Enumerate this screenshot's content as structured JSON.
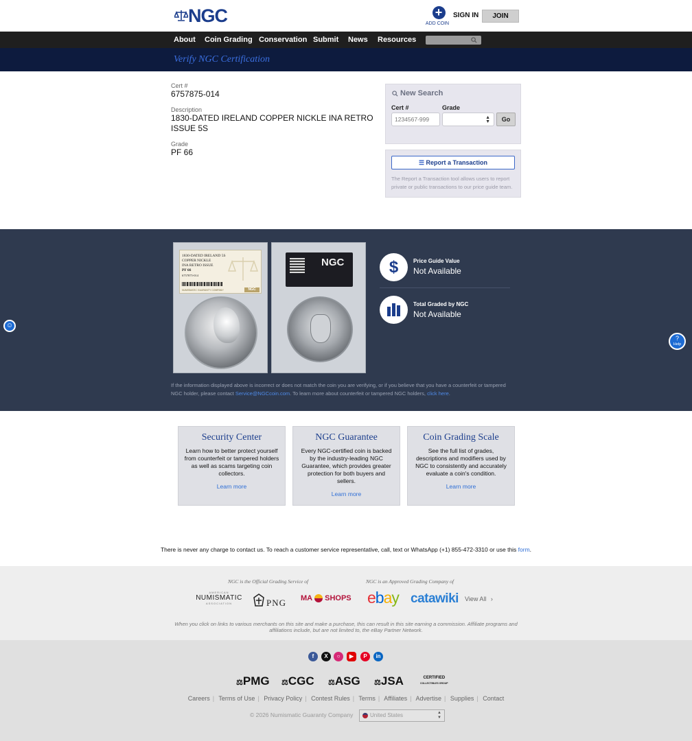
{
  "header": {
    "logo": "NGC",
    "add_coin": "ADD COIN",
    "sign_in": "SIGN IN",
    "join": "JOIN"
  },
  "nav": {
    "items": [
      "About",
      "Coin Grading",
      "Conservation",
      "Submit",
      "News",
      "Resources"
    ]
  },
  "verify": {
    "title": "Verify NGC Certification"
  },
  "cert": {
    "cert_label": "Cert #",
    "cert_value": "6757875-014",
    "desc_label": "Description",
    "desc_value": "1830-DATED IRELAND COPPER NICKLE INA RETRO ISSUE 5S",
    "grade_label": "Grade",
    "grade_value": "PF 66"
  },
  "new_search": {
    "title": "New Search",
    "cert_label": "Cert #",
    "cert_placeholder": "1234567-999",
    "grade_label": "Grade",
    "go": "Go"
  },
  "report": {
    "button": "Report a Transaction",
    "text": "The Report a Transaction tool allows users to report private or public transactions to our price guide team."
  },
  "slab": {
    "line1": "1830-DATED IRELAND 5S",
    "line2": "COPPER NICKLE",
    "line3": "INA RETRO ISSUE",
    "grade": "PF 66",
    "cert": "6757875-014",
    "guarantee": "NUMISMATIC GUARANTY COMPANY",
    "brand": "NGC"
  },
  "stats": {
    "price_label": "Price Guide Value",
    "price_value": "Not Available",
    "graded_label": "Total Graded by NGC",
    "graded_value": "Not Available"
  },
  "notice": {
    "text1": "If the information displayed above is incorrect or does not match the coin you are verifying, or if you believe that you have a counterfeit or tampered NGC holder, please contact ",
    "email": "Service@NGCcoin.com",
    "text2": ". To learn more about counterfeit or tampered NGC holders, ",
    "click": "click here",
    "text3": "."
  },
  "help": "Help",
  "cards": [
    {
      "title": "Security Center",
      "text": "Learn how to better protect yourself from counterfeit or tampered holders as well as scams targeting coin collectors.",
      "link": "Learn more"
    },
    {
      "title": "NGC Guarantee",
      "text": "Every NGC-certified coin is backed by the industry-leading NGC Guarantee, which provides greater protection for both buyers and sellers.",
      "link": "Learn more"
    },
    {
      "title": "Coin Grading Scale",
      "text": "See the full list of grades, descriptions and modifiers used by NGC to consistently and accurately evaluate a coin's condition.",
      "link": "Learn more"
    }
  ],
  "contact": {
    "text": "There is never any charge to contact us. To reach a customer service representative, call, text or WhatsApp (+1) 855-472-3310 or use this ",
    "link": "form",
    "end": "."
  },
  "partners": {
    "official_label": "NGC is the Official Grading Service of",
    "approved_label": "NGC is an Approved Grading Company of",
    "ana_small": "AMERICAN",
    "ana": "NUMISMATIC",
    "ana_sub": "ASSOCIATION",
    "png": "PNG",
    "ma": "MA",
    "shops": "SHOPS",
    "ebay": "ebay",
    "catawiki": "catawiki",
    "view_all": "View All",
    "disclaimer": "When you click on links to various merchants on this site and make a purchase, this can result in this site earning a commission. Affiliate programs and affiliations include, but are not limited to, the eBay Partner Network."
  },
  "footer": {
    "social": [
      "facebook-icon",
      "x-icon",
      "instagram-icon",
      "youtube-icon",
      "pinterest-icon",
      "linkedin-icon"
    ],
    "brands": [
      "PMG",
      "CGC",
      "ASG",
      "JSA"
    ],
    "ccg_top": "CERTIFIED",
    "ccg_bottom": "COLLECTIBLES GROUP",
    "links": [
      "Careers",
      "Terms of Use",
      "Privacy Policy",
      "Contest Rules",
      "Terms",
      "Affiliates",
      "Advertise",
      "Supplies",
      "Contact"
    ],
    "copyright": "© 2026 Numismatic Guaranty Company",
    "country": "United States"
  }
}
